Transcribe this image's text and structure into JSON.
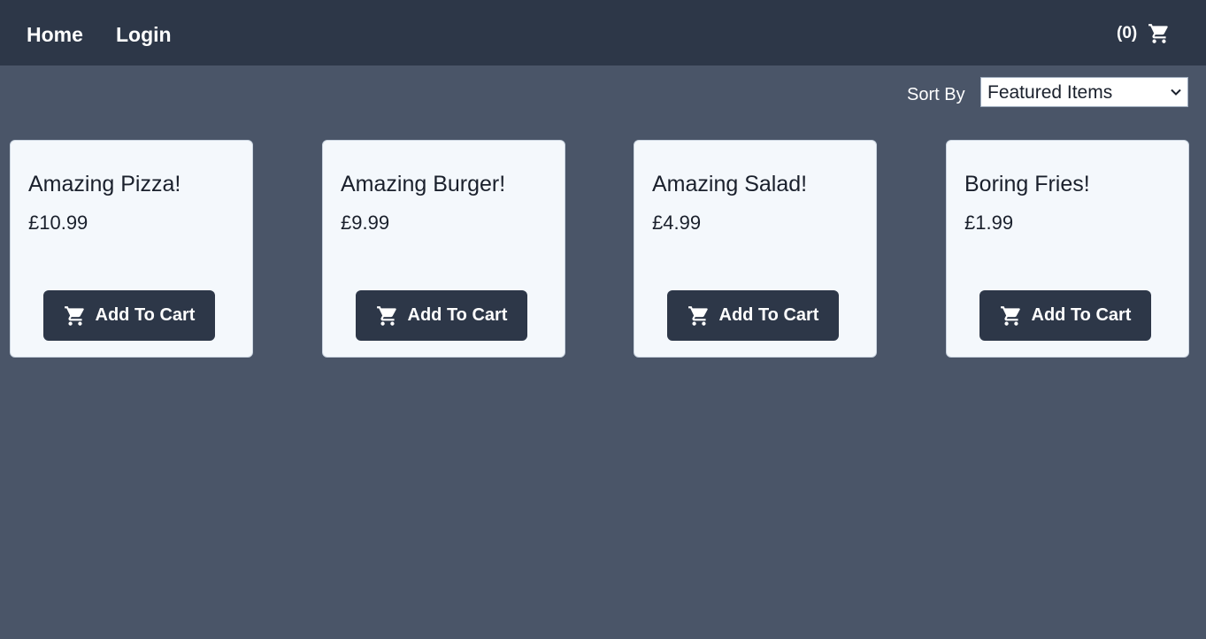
{
  "nav": {
    "home_label": "Home",
    "login_label": "Login",
    "cart_count": "(0)",
    "cart_icon": "shopping-cart-icon"
  },
  "sort": {
    "label": "Sort By",
    "selected": "Featured Items"
  },
  "products": [
    {
      "name": "Amazing Pizza!",
      "price": "£10.99",
      "button_label": "Add To Cart"
    },
    {
      "name": "Amazing Burger!",
      "price": "£9.99",
      "button_label": "Add To Cart"
    },
    {
      "name": "Amazing Salad!",
      "price": "£4.99",
      "button_label": "Add To Cart"
    },
    {
      "name": "Boring Fries!",
      "price": "£1.99",
      "button_label": "Add To Cart"
    }
  ],
  "colors": {
    "navbar": "#2d3748",
    "page_background": "#4a5568",
    "card_background": "#f4f8fc",
    "button": "#2d3748"
  }
}
